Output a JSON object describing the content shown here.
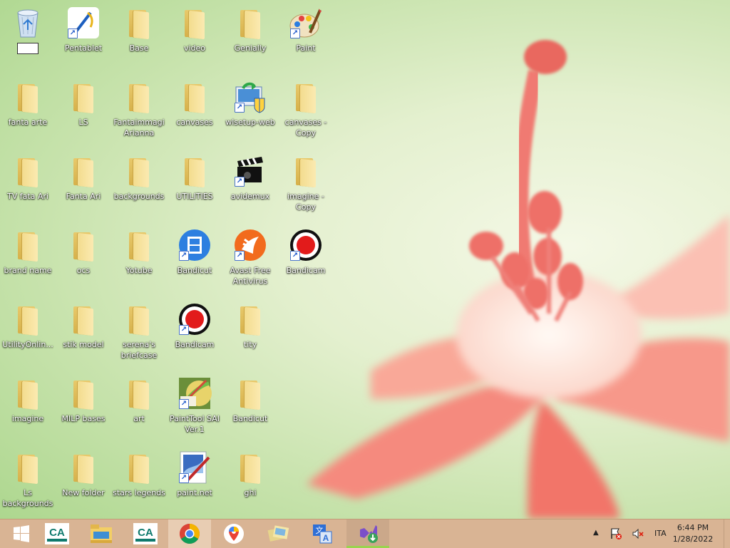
{
  "desktop": {
    "icons": [
      {
        "label": "",
        "type": "recycle-bin"
      },
      {
        "label": "Pentablet",
        "type": "app"
      },
      {
        "label": "Base",
        "type": "folder"
      },
      {
        "label": "video",
        "type": "folder"
      },
      {
        "label": "Genially",
        "type": "folder"
      },
      {
        "label": "Paint",
        "type": "app"
      },
      {
        "label": "fanta arte",
        "type": "folder"
      },
      {
        "label": "LS",
        "type": "folder"
      },
      {
        "label": "Fantaimmagi Arianna",
        "type": "folder"
      },
      {
        "label": "canvases",
        "type": "folder"
      },
      {
        "label": "wlsetup-web",
        "type": "app"
      },
      {
        "label": "canvases - Copy",
        "type": "folder"
      },
      {
        "label": "TV fata Ari",
        "type": "folder"
      },
      {
        "label": "Fanta Ari",
        "type": "folder"
      },
      {
        "label": "backgrounds",
        "type": "folder"
      },
      {
        "label": "UTILITIES",
        "type": "folder"
      },
      {
        "label": "avidemux",
        "type": "app"
      },
      {
        "label": "imagine - Copy",
        "type": "folder"
      },
      {
        "label": "brand name",
        "type": "folder"
      },
      {
        "label": "ocs",
        "type": "folder"
      },
      {
        "label": "Yotube",
        "type": "folder"
      },
      {
        "label": "Bandicut",
        "type": "app"
      },
      {
        "label": "Avast Free Antivirus",
        "type": "app"
      },
      {
        "label": "Bandicam",
        "type": "app"
      },
      {
        "label": "UtilityOnlin...",
        "type": "folder"
      },
      {
        "label": "stik model",
        "type": "folder"
      },
      {
        "label": "serena's briefcase",
        "type": "folder"
      },
      {
        "label": "Bandicam",
        "type": "app"
      },
      {
        "label": "tity",
        "type": "folder"
      },
      {
        "label": "imagine",
        "type": "folder"
      },
      {
        "label": "MILP bases",
        "type": "folder"
      },
      {
        "label": "art",
        "type": "folder"
      },
      {
        "label": "PaintTool SAI Ver.1",
        "type": "app"
      },
      {
        "label": "Bandicut",
        "type": "folder"
      },
      {
        "label": "Ls backgrounds",
        "type": "folder"
      },
      {
        "label": "New folder",
        "type": "folder"
      },
      {
        "label": "stars legends",
        "type": "folder"
      },
      {
        "label": "paint.net",
        "type": "app"
      },
      {
        "label": "ghi",
        "type": "folder"
      }
    ]
  },
  "taskbar": {
    "start": "start-icon",
    "apps": [
      "credit-agricole-icon",
      "file-explorer-icon",
      "credit-agricole-icon",
      "chrome-icon",
      "maps-icon",
      "photos-icon",
      "translator-icon",
      "visual-studio-installer-icon"
    ],
    "tray": {
      "language": "ITA",
      "time": "6:44 PM",
      "date": "1/28/2022"
    }
  }
}
